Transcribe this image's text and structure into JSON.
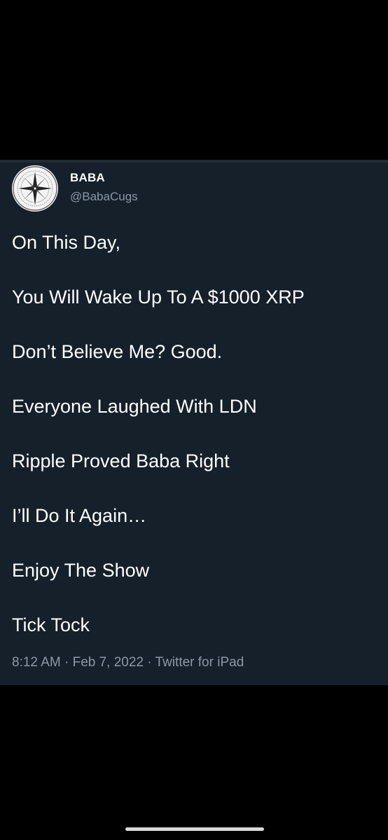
{
  "tweet": {
    "author": {
      "display_name": "BABA",
      "handle": "@BabaCugs",
      "avatar_icon": "compass-rose-icon"
    },
    "lines": [
      "On This Day,",
      "You Will Wake Up To A $1000 XRP",
      "Don’t Believe Me? Good.",
      "Everyone Laughed With LDN",
      "Ripple Proved Baba Right",
      "I’ll Do It Again…",
      "Enjoy The Show",
      "Tick Tock"
    ],
    "meta": "8:12 AM · Feb 7, 2022 · Twitter for iPad"
  },
  "colors": {
    "card_background": "#15202b",
    "screen_background": "#000000",
    "primary_text": "#ffffff",
    "secondary_text": "#8b98a5"
  }
}
